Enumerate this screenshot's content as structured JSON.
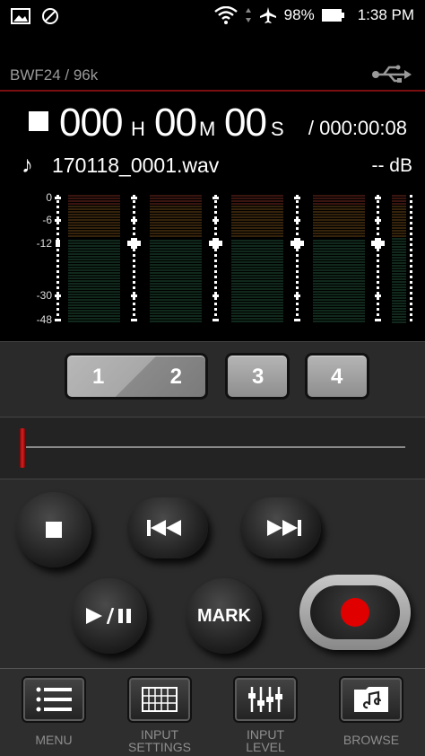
{
  "status": {
    "battery": "98%",
    "time": "1:38 PM"
  },
  "header": {
    "format": "BWF24 / 96k"
  },
  "counter": {
    "hours": "000",
    "h_unit": "H",
    "minutes": "00",
    "m_unit": "M",
    "seconds": "00",
    "s_unit": "S",
    "total": "/ 000:00:08"
  },
  "file": {
    "name": "170118_0001.wav",
    "level": "-- dB"
  },
  "meter": {
    "scale": [
      "0",
      "-6",
      "-12",
      "-30",
      "-48"
    ],
    "channels": 4
  },
  "channels": {
    "btn12_a": "1",
    "btn12_b": "2",
    "btn3": "3",
    "btn4": "4"
  },
  "transport": {
    "mark": "MARK"
  },
  "nav": {
    "menu": "MENU",
    "input_settings_1": "INPUT",
    "input_settings_2": "SETTINGS",
    "input_level_1": "INPUT",
    "input_level_2": "LEVEL",
    "browse": "BROWSE"
  },
  "colors": {
    "accent_red": "#e00000",
    "divider_red": "#7a0e10",
    "meter_green": "#133322",
    "meter_orange": "#3a2208"
  }
}
